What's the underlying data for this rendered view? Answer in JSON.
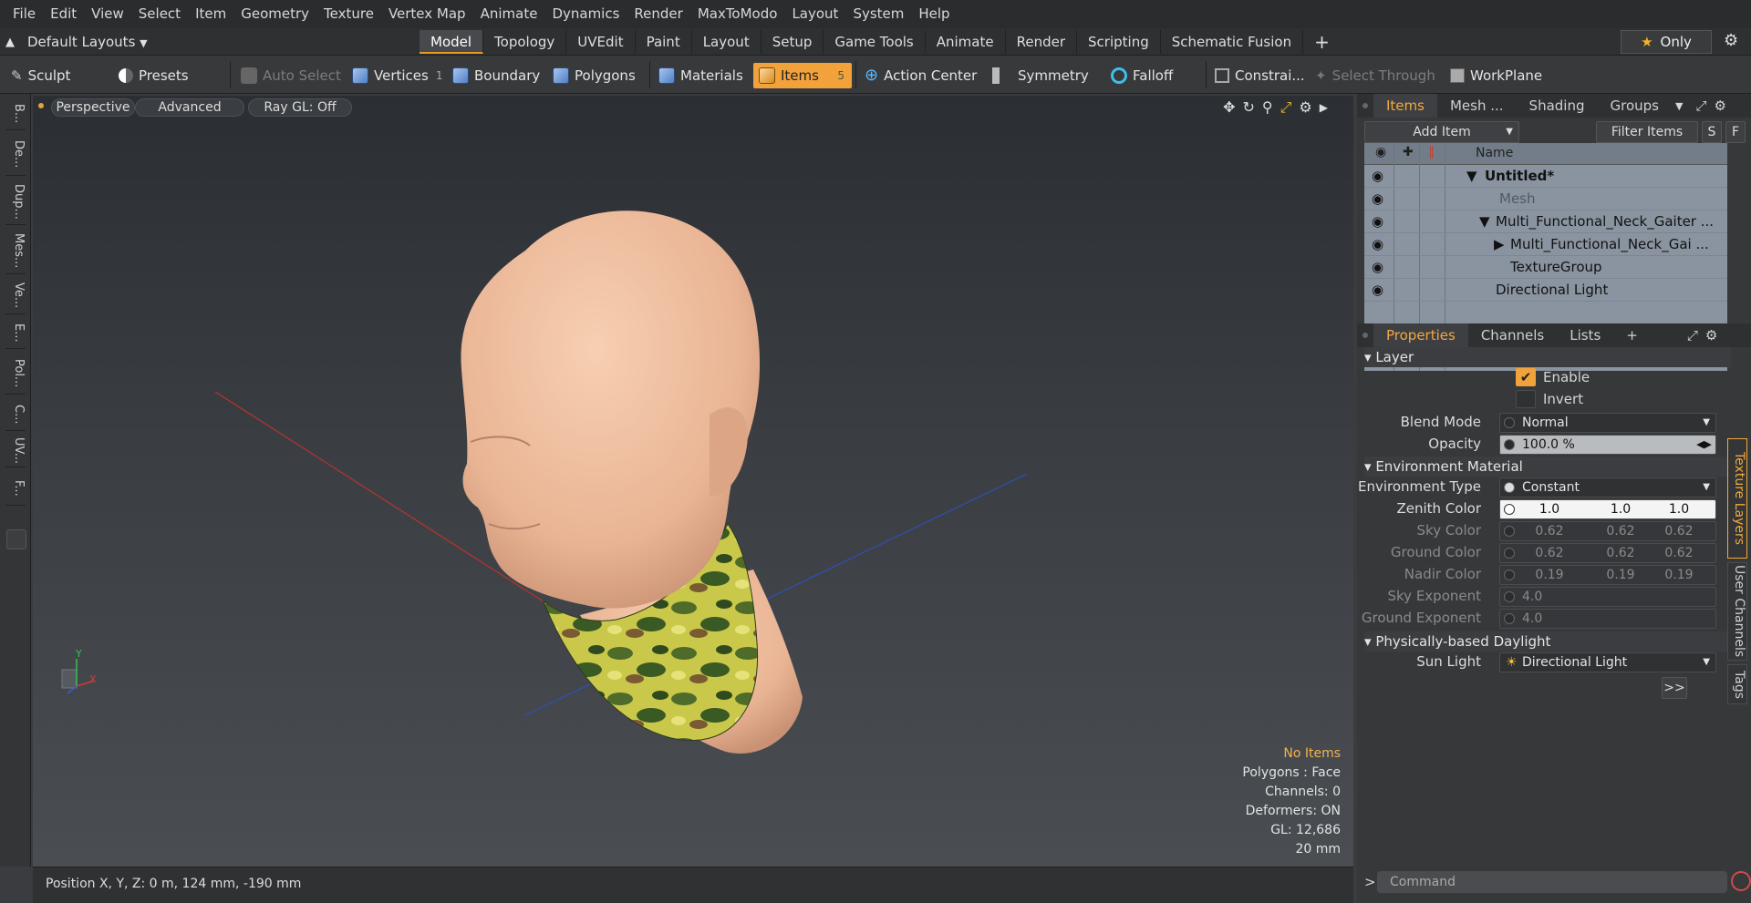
{
  "menu": [
    "File",
    "Edit",
    "View",
    "Select",
    "Item",
    "Geometry",
    "Texture",
    "Vertex Map",
    "Animate",
    "Dynamics",
    "Render",
    "MaxToModo",
    "Layout",
    "System",
    "Help"
  ],
  "layouts_label": "Default Layouts",
  "tabs": [
    "Model",
    "Topology",
    "UVEdit",
    "Paint",
    "Layout",
    "Setup",
    "Game Tools",
    "Animate",
    "Render",
    "Scripting",
    "Schematic Fusion"
  ],
  "tab_add": "+",
  "only_label": "Only",
  "toolbar": {
    "sculpt": "Sculpt",
    "presets": "Presets",
    "auto_select": "Auto Select",
    "vertices": "Vertices",
    "vertices_count": "1",
    "boundary": "Boundary",
    "polygons": "Polygons",
    "materials": "Materials",
    "items": "Items",
    "items_count": "5",
    "action_center": "Action Center",
    "symmetry": "Symmetry",
    "falloff": "Falloff",
    "constraints": "Constrai...",
    "select_through": "Select Through",
    "workplane": "WorkPlane"
  },
  "left_tools": [
    "B...",
    "De...",
    "Dup...",
    "Mes...",
    "Ve...",
    "E...",
    "Pol...",
    "C...",
    "UV...",
    "F..."
  ],
  "viewport": {
    "perspective": "Perspective",
    "advanced": "Advanced",
    "raygl": "Ray GL: Off",
    "stats": {
      "no_items": "No Items",
      "polygons": "Polygons : Face",
      "channels": "Channels: 0",
      "deformers": "Deformers: ON",
      "gl": "GL: 12,686",
      "size": "20 mm"
    },
    "axis_y": "Y",
    "axis_x": "X"
  },
  "status": "Position X, Y, Z:   0 m, 124 mm, -190 mm",
  "items_panel": {
    "tabs": [
      "Items",
      "Mesh ...",
      "Shading",
      "Groups"
    ],
    "add_item": "Add Item",
    "filter_items": "Filter Items",
    "s": "S",
    "f": "F",
    "name_header": "Name",
    "rows": [
      "Untitled*",
      "Mesh",
      "Multi_Functional_Neck_Gaiter ...",
      "Multi_Functional_Neck_Gai ...",
      "TextureGroup",
      "Directional Light"
    ]
  },
  "properties": {
    "tabs": [
      "Properties",
      "Channels",
      "Lists",
      "+"
    ],
    "layer_section": "Layer",
    "enable": "Enable",
    "invert": "Invert",
    "blend_mode_label": "Blend Mode",
    "blend_mode": "Normal",
    "opacity_label": "Opacity",
    "opacity": "100.0 %",
    "env_section": "Environment Material",
    "env_type_label": "Environment Type",
    "env_type": "Constant",
    "zenith_label": "Zenith Color",
    "zenith": [
      "1.0",
      "1.0",
      "1.0"
    ],
    "sky_label": "Sky Color",
    "sky": [
      "0.62",
      "0.62",
      "0.62"
    ],
    "ground_label": "Ground Color",
    "ground": [
      "0.62",
      "0.62",
      "0.62"
    ],
    "nadir_label": "Nadir Color",
    "nadir": [
      "0.19",
      "0.19",
      "0.19"
    ],
    "sky_exp_label": "Sky Exponent",
    "sky_exp": "4.0",
    "ground_exp_label": "Ground Exponent",
    "ground_exp": "4.0",
    "daylight_section": "Physically-based Daylight",
    "sun_label": "Sun Light",
    "sun": "Directional Light",
    "more": ">>"
  },
  "side_tabs": [
    "Texture Layers",
    "User Channels",
    "Tags"
  ],
  "command_placeholder": "Command",
  "command_prompt": ">"
}
